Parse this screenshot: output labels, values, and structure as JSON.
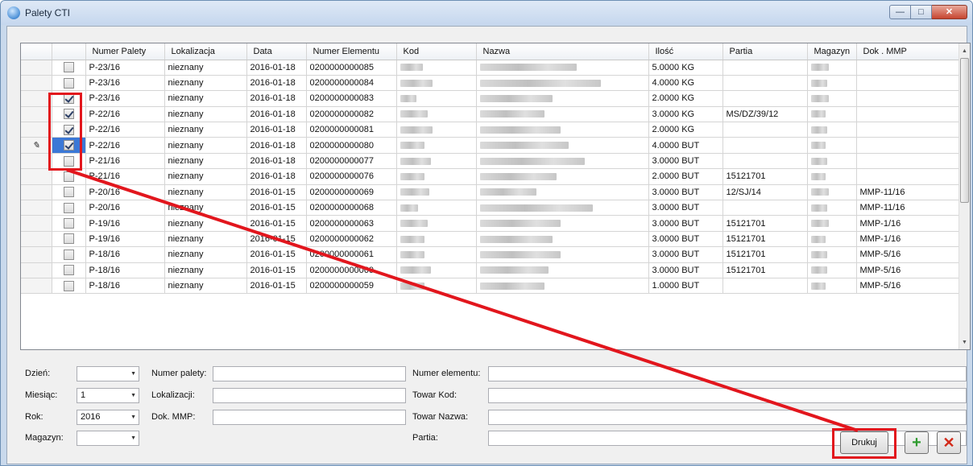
{
  "window": {
    "title": "Palety CTI",
    "min_glyph": "—",
    "max_glyph": "□",
    "close_glyph": "✕"
  },
  "grid": {
    "columns": [
      "",
      "",
      "Numer Palety",
      "Lokalizacja",
      "Data",
      "Numer Elementu",
      "Kod",
      "Nazwa",
      "Ilość",
      "Partia",
      "Magazyn",
      "Dok . MMP"
    ],
    "editing_glyph": "✎",
    "rows": [
      {
        "checked": false,
        "selected": false,
        "editing": false,
        "numer": "P-23/16",
        "lok": "nieznany",
        "data": "2016-01-18",
        "element": "0200000000085",
        "ilosc": "5.0000 KG",
        "partia": "",
        "mmp": ""
      },
      {
        "checked": false,
        "selected": false,
        "editing": false,
        "numer": "P-23/16",
        "lok": "nieznany",
        "data": "2016-01-18",
        "element": "0200000000084",
        "ilosc": "4.0000 KG",
        "partia": "",
        "mmp": ""
      },
      {
        "checked": true,
        "selected": false,
        "editing": false,
        "numer": "P-23/16",
        "lok": "nieznany",
        "data": "2016-01-18",
        "element": "0200000000083",
        "ilosc": "2.0000 KG",
        "partia": "",
        "mmp": ""
      },
      {
        "checked": true,
        "selected": false,
        "editing": false,
        "numer": "P-22/16",
        "lok": "nieznany",
        "data": "2016-01-18",
        "element": "0200000000082",
        "ilosc": "3.0000 KG",
        "partia": "MS/DZ/39/12",
        "mmp": ""
      },
      {
        "checked": true,
        "selected": false,
        "editing": false,
        "numer": "P-22/16",
        "lok": "nieznany",
        "data": "2016-01-18",
        "element": "0200000000081",
        "ilosc": "2.0000 KG",
        "partia": "",
        "mmp": ""
      },
      {
        "checked": true,
        "selected": true,
        "editing": true,
        "numer": "P-22/16",
        "lok": "nieznany",
        "data": "2016-01-18",
        "element": "0200000000080",
        "ilosc": "4.0000 BUT",
        "partia": "",
        "mmp": ""
      },
      {
        "checked": false,
        "selected": false,
        "editing": false,
        "numer": "P-21/16",
        "lok": "nieznany",
        "data": "2016-01-18",
        "element": "0200000000077",
        "ilosc": "3.0000 BUT",
        "partia": "",
        "mmp": ""
      },
      {
        "checked": false,
        "selected": false,
        "editing": false,
        "numer": "P-21/16",
        "lok": "nieznany",
        "data": "2016-01-18",
        "element": "0200000000076",
        "ilosc": "2.0000 BUT",
        "partia": "15121701",
        "mmp": ""
      },
      {
        "checked": false,
        "selected": false,
        "editing": false,
        "numer": "P-20/16",
        "lok": "nieznany",
        "data": "2016-01-15",
        "element": "0200000000069",
        "ilosc": "3.0000 BUT",
        "partia": "12/SJ/14",
        "mmp": "MMP-11/16"
      },
      {
        "checked": false,
        "selected": false,
        "editing": false,
        "numer": "P-20/16",
        "lok": "nieznany",
        "data": "2016-01-15",
        "element": "0200000000068",
        "ilosc": "3.0000 BUT",
        "partia": "",
        "mmp": "MMP-11/16"
      },
      {
        "checked": false,
        "selected": false,
        "editing": false,
        "numer": "P-19/16",
        "lok": "nieznany",
        "data": "2016-01-15",
        "element": "0200000000063",
        "ilosc": "3.0000 BUT",
        "partia": "15121701",
        "mmp": "MMP-1/16"
      },
      {
        "checked": false,
        "selected": false,
        "editing": false,
        "numer": "P-19/16",
        "lok": "nieznany",
        "data": "2016-01-15",
        "element": "0200000000062",
        "ilosc": "3.0000 BUT",
        "partia": "15121701",
        "mmp": "MMP-1/16"
      },
      {
        "checked": false,
        "selected": false,
        "editing": false,
        "numer": "P-18/16",
        "lok": "nieznany",
        "data": "2016-01-15",
        "element": "0200000000061",
        "ilosc": "3.0000 BUT",
        "partia": "15121701",
        "mmp": "MMP-5/16"
      },
      {
        "checked": false,
        "selected": false,
        "editing": false,
        "numer": "P-18/16",
        "lok": "nieznany",
        "data": "2016-01-15",
        "element": "0200000000060",
        "ilosc": "3.0000 BUT",
        "partia": "15121701",
        "mmp": "MMP-5/16"
      },
      {
        "checked": false,
        "selected": false,
        "editing": false,
        "numer": "P-18/16",
        "lok": "nieznany",
        "data": "2016-01-15",
        "element": "0200000000059",
        "ilosc": "1.0000 BUT",
        "partia": "",
        "mmp": "MMP-5/16"
      }
    ]
  },
  "filters": {
    "dzien_label": "Dzień:",
    "dzien_value": "",
    "miesiac_label": "Miesiąc:",
    "miesiac_value": "1",
    "rok_label": "Rok:",
    "rok_value": "2016",
    "magazyn_label": "Magazyn:",
    "magazyn_value": "",
    "numer_palety_label": "Numer palety:",
    "numer_palety_value": "",
    "lokalizacja_label": "Lokalizacji:",
    "lokalizacja_value": "",
    "dok_mmp_label": "Dok. MMP:",
    "dok_mmp_value": "",
    "numer_elementu_label": "Numer elementu:",
    "numer_elementu_value": "",
    "towar_kod_label": "Towar Kod:",
    "towar_kod_value": "",
    "towar_nazwa_label": "Towar Nazwa:",
    "towar_nazwa_value": "",
    "partia_label": "Partia:",
    "partia_value": "",
    "dropdown_glyph": "▼"
  },
  "buttons": {
    "drukuj": "Drukuj",
    "add_glyph": "+",
    "cancel_glyph": "✕"
  },
  "scroll": {
    "up_glyph": "▲",
    "down_glyph": "▼"
  },
  "colors": {
    "annotation_red": "#e2161d",
    "selection_blue": "#3b78d6"
  },
  "icons": [
    "app-icon",
    "pencil-icon",
    "plus-icon",
    "close-icon",
    "dropdown-arrow-icon"
  ]
}
